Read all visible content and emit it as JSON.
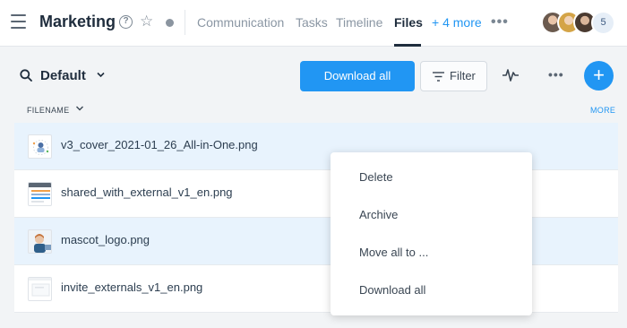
{
  "header": {
    "title": "Marketing",
    "help_icon": "question-circle-icon",
    "star_icon": "star-outline-icon",
    "status_dot_color": "#8b95a0",
    "tabs": [
      {
        "label": "Communication",
        "active": false
      },
      {
        "label": "Tasks",
        "active": false
      },
      {
        "label": "Timeline",
        "active": false
      },
      {
        "label": "Files",
        "active": true
      }
    ],
    "more_tabs": "+ 4 more",
    "member_count": "5"
  },
  "toolbar": {
    "view_name": "Default",
    "download_all": "Download all",
    "filter": "Filter",
    "accent_color": "#2196f3"
  },
  "table": {
    "column_header": "FILENAME",
    "more": "MORE",
    "files": [
      {
        "name": "v3_cover_2021-01_26_All-in-One.png",
        "selected": true
      },
      {
        "name": "shared_with_external_v1_en.png",
        "selected": false
      },
      {
        "name": "mascot_logo.png",
        "selected": true
      },
      {
        "name": "invite_externals_v1_en.png",
        "selected": false
      }
    ]
  },
  "context_menu": {
    "items": [
      "Delete",
      "Archive",
      "Move all to ...",
      "Download all"
    ]
  }
}
